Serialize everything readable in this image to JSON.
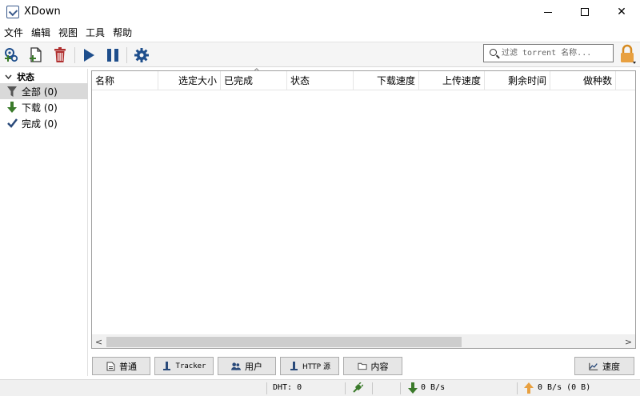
{
  "window": {
    "title": "XDown",
    "minimize_icon": "minimize-icon",
    "maximize_icon": "maximize-icon",
    "close_symbol": "✕"
  },
  "menu": [
    "文件",
    "编辑",
    "视图",
    "工具",
    "帮助"
  ],
  "toolbar": {
    "icons": [
      "add-torrent-icon",
      "add-file-icon",
      "delete-icon",
      "resume-icon",
      "pause-icon",
      "settings-icon"
    ],
    "search_placeholder": "过滤 torrent 名称...",
    "lock_icon": "lock-icon"
  },
  "sidebar": {
    "header": "状态",
    "items": [
      {
        "label": "全部 (0)",
        "icon": "filter-icon",
        "color": "#555555"
      },
      {
        "label": "下载 (0)",
        "icon": "download-arrow-icon",
        "color": "#3a7a2a"
      },
      {
        "label": "完成 (0)",
        "icon": "check-icon",
        "color": "#2a4a7a"
      }
    ]
  },
  "table": {
    "columns": [
      "名称",
      "选定大小",
      "已完成",
      "状态",
      "下载速度",
      "上传速度",
      "剩余时间",
      "做种数"
    ],
    "sort_indicator": "^",
    "scroll_left": "<",
    "scroll_right": ">"
  },
  "tabs": [
    {
      "label": "普通",
      "icon": "document-icon"
    },
    {
      "label": "Tracker",
      "icon": "tracker-icon"
    },
    {
      "label": "用户",
      "icon": "users-icon"
    },
    {
      "label": "HTTP 源",
      "icon": "http-source-icon"
    },
    {
      "label": "内容",
      "icon": "folder-icon"
    }
  ],
  "speed_button": {
    "label": "速度",
    "icon": "chart-icon"
  },
  "statusbar": {
    "dht": "DHT: 0",
    "download": "0 B/s",
    "upload": "0 B/s (0 B)"
  },
  "colors": {
    "accent_green": "#3a7a2a",
    "accent_blue": "#1e4e8c",
    "delete_red": "#b03030",
    "upload_orange": "#e8a040"
  }
}
